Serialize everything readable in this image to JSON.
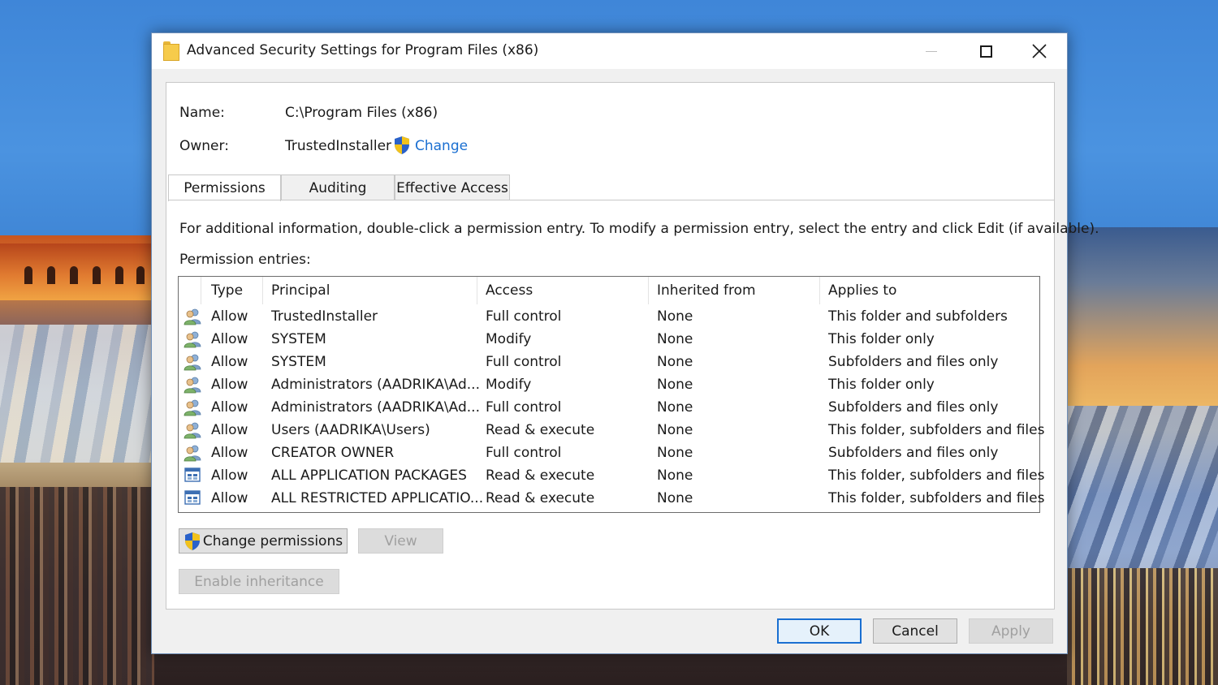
{
  "window": {
    "title": "Advanced Security Settings for Program Files (x86)"
  },
  "info": {
    "name_label": "Name:",
    "name_value": "C:\\Program Files (x86)",
    "owner_label": "Owner:",
    "owner_value": "TrustedInstaller",
    "change_link": "Change"
  },
  "tabs": [
    {
      "label": "Permissions",
      "active": true
    },
    {
      "label": "Auditing",
      "active": false
    },
    {
      "label": "Effective Access",
      "active": false
    }
  ],
  "instructions": "For additional information, double-click a permission entry. To modify a permission entry, select the entry and click Edit (if available).",
  "entries_label": "Permission entries:",
  "columns": [
    "Type",
    "Principal",
    "Access",
    "Inherited from",
    "Applies to"
  ],
  "rows": [
    {
      "icon": "users-icon",
      "type": "Allow",
      "principal": "TrustedInstaller",
      "access": "Full control",
      "inherited": "None",
      "applies": "This folder and subfolders"
    },
    {
      "icon": "users-icon",
      "type": "Allow",
      "principal": "SYSTEM",
      "access": "Modify",
      "inherited": "None",
      "applies": "This folder only"
    },
    {
      "icon": "users-icon",
      "type": "Allow",
      "principal": "SYSTEM",
      "access": "Full control",
      "inherited": "None",
      "applies": "Subfolders and files only"
    },
    {
      "icon": "users-icon",
      "type": "Allow",
      "principal": "Administrators (AADRIKA\\Ad...",
      "access": "Modify",
      "inherited": "None",
      "applies": "This folder only"
    },
    {
      "icon": "users-icon",
      "type": "Allow",
      "principal": "Administrators (AADRIKA\\Ad...",
      "access": "Full control",
      "inherited": "None",
      "applies": "Subfolders and files only"
    },
    {
      "icon": "users-icon",
      "type": "Allow",
      "principal": "Users (AADRIKA\\Users)",
      "access": "Read & execute",
      "inherited": "None",
      "applies": "This folder, subfolders and files"
    },
    {
      "icon": "users-icon",
      "type": "Allow",
      "principal": "CREATOR OWNER",
      "access": "Full control",
      "inherited": "None",
      "applies": "Subfolders and files only"
    },
    {
      "icon": "app-package-icon",
      "type": "Allow",
      "principal": "ALL APPLICATION PACKAGES",
      "access": "Read & execute",
      "inherited": "None",
      "applies": "This folder, subfolders and files"
    },
    {
      "icon": "app-package-icon",
      "type": "Allow",
      "principal": "ALL RESTRICTED APPLICATIO...",
      "access": "Read & execute",
      "inherited": "None",
      "applies": "This folder, subfolders and files"
    }
  ],
  "buttons": {
    "change_permissions": "Change permissions",
    "view": "View",
    "enable_inheritance": "Enable inheritance",
    "ok": "OK",
    "cancel": "Cancel",
    "apply": "Apply"
  },
  "colors": {
    "link": "#1a6fd1",
    "shield_blue": "#2a62c9",
    "shield_yellow": "#f2c21b"
  }
}
